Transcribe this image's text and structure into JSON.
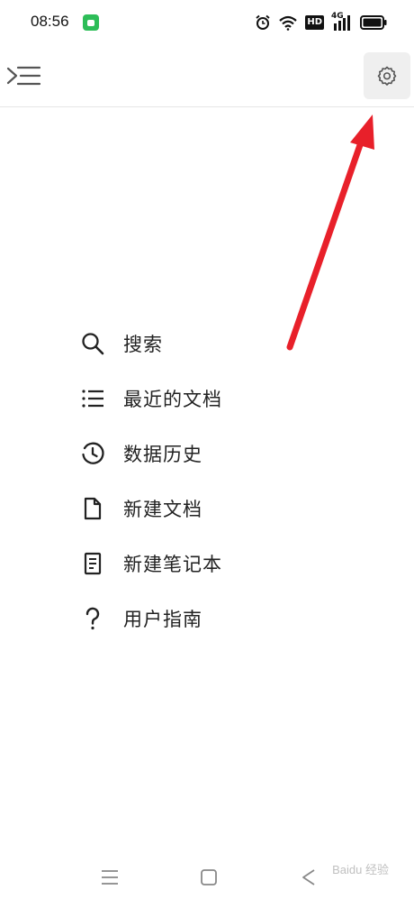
{
  "status_bar": {
    "time": "08:56",
    "network_label": "4G",
    "hd_label": "HD",
    "icons": [
      "app-notification-icon",
      "alarm-icon",
      "wifi-icon",
      "hd-icon",
      "signal-icon",
      "battery-icon"
    ]
  },
  "app_bar": {
    "menu_toggle_icon": "sidebar-collapse-icon",
    "settings_icon": "gear-icon"
  },
  "menu": {
    "items": [
      {
        "label": "搜索",
        "icon": "search-icon"
      },
      {
        "label": "最近的文档",
        "icon": "list-icon"
      },
      {
        "label": "数据历史",
        "icon": "history-clock-icon"
      },
      {
        "label": "新建文档",
        "icon": "document-icon"
      },
      {
        "label": "新建笔记本",
        "icon": "notebook-icon"
      },
      {
        "label": "用户指南",
        "icon": "question-icon"
      }
    ]
  },
  "bottom_nav": {
    "icons": [
      "recent-apps-icon",
      "home-icon",
      "back-icon"
    ]
  },
  "watermark": "Baidu 经验",
  "colors": {
    "arrow": "#e8202a",
    "settings_bg": "#efefef",
    "text": "#222222"
  }
}
